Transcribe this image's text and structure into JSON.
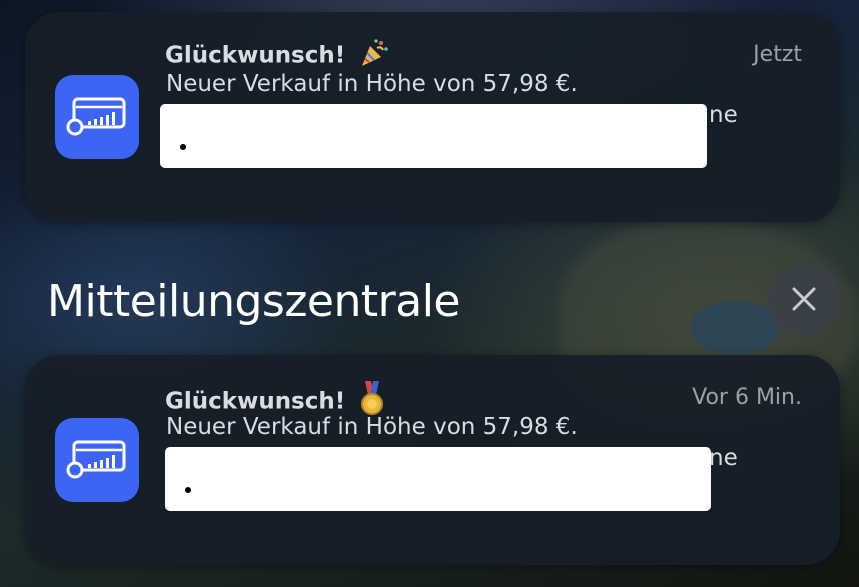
{
  "section": {
    "title": "Mitteilungszentrale"
  },
  "notifications": [
    {
      "title": "Glückwunsch!",
      "emoji": "party-popper",
      "time": "Jetzt",
      "body": "Neuer Verkauf in Höhe von 57,98 €.",
      "hidden_text_tail": "ne",
      "app_icon": "sales-register-icon"
    },
    {
      "title": "Glückwunsch!",
      "emoji": "medal",
      "time": "Vor 6 Min.",
      "body": "Neuer Verkauf in Höhe von 57,98 €.",
      "hidden_text_tail": "ne",
      "app_icon": "sales-register-icon"
    }
  ],
  "colors": {
    "app_icon_bg": "#3d64f2",
    "notification_bg": "#161e28",
    "text_primary": "#d9dde3",
    "text_secondary": "#9aa1aa"
  }
}
